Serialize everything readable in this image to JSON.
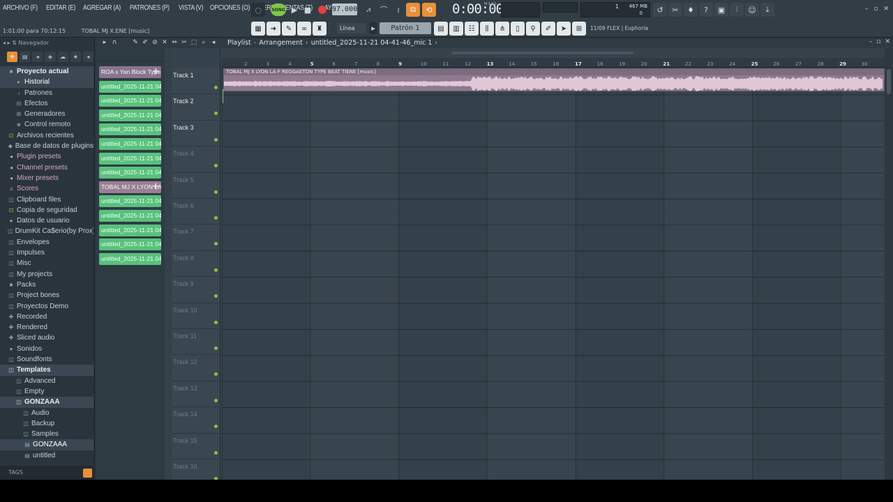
{
  "menu": [
    "ARCHIVO (F)",
    "EDITAR (E)",
    "AGREGAR (A)",
    "PATRONES (P)",
    "VISTA (V)",
    "OPCIONES (O)",
    "HERRAMIENTAS (T)",
    "AYUDA"
  ],
  "hint": {
    "position": "1:01:00 para 70:12:15",
    "song_name": "TOBAL MJ X.ENE [music]"
  },
  "transport": {
    "song_mode": "SONG",
    "tempo": "97.000",
    "time": "0:00:00",
    "time_unit_label": "M:S:CS"
  },
  "monitor": {
    "cpu_value": "1",
    "ram": "467 MB",
    "polyphony": "0"
  },
  "toolbar": {
    "snap": "Línea",
    "pattern": "Patrón 1",
    "plugin_note": "11/09  FLEX | Euphoria"
  },
  "browser": {
    "title": "Navegador",
    "items": [
      {
        "label": "Proyecto actual",
        "icon": "■",
        "level": 0,
        "kind": "hl"
      },
      {
        "label": "Historial",
        "icon": "▸",
        "level": 1,
        "kind": "sel"
      },
      {
        "label": "Patrones",
        "icon": "♪",
        "level": 1,
        "kind": ""
      },
      {
        "label": "Efectos",
        "icon": "⊟",
        "level": 1,
        "kind": ""
      },
      {
        "label": "Generadores",
        "icon": "⊞",
        "level": 1,
        "kind": ""
      },
      {
        "label": "Control remoto",
        "icon": "◈",
        "level": 1,
        "kind": ""
      },
      {
        "label": "Archivos recientes",
        "icon": "⊡",
        "level": 0,
        "kind": "green"
      },
      {
        "label": "Base de datos de plugins",
        "icon": "◆",
        "level": 0,
        "kind": ""
      },
      {
        "label": "Plugin presets",
        "icon": "◂",
        "level": 0,
        "kind": "pink"
      },
      {
        "label": "Channel presets",
        "icon": "◂",
        "level": 0,
        "kind": "pink"
      },
      {
        "label": "Mixer presets",
        "icon": "◂",
        "level": 0,
        "kind": "pink"
      },
      {
        "label": "Scores",
        "icon": "♫",
        "level": 0,
        "kind": "pink"
      },
      {
        "label": "Clipboard files",
        "icon": "◫",
        "level": 0,
        "kind": ""
      },
      {
        "label": "Copia de seguridad",
        "icon": "⊡",
        "level": 0,
        "kind": "green"
      },
      {
        "label": "Datos de usuario",
        "icon": "●",
        "level": 0,
        "kind": ""
      },
      {
        "label": "DrumKit Ca$erio(by Prox)",
        "icon": "◫",
        "level": 0,
        "kind": ""
      },
      {
        "label": "Envelopes",
        "icon": "◫",
        "level": 0,
        "kind": ""
      },
      {
        "label": "Impulses",
        "icon": "◫",
        "level": 0,
        "kind": ""
      },
      {
        "label": "Misc",
        "icon": "◫",
        "level": 0,
        "kind": ""
      },
      {
        "label": "My projects",
        "icon": "◫",
        "level": 0,
        "kind": ""
      },
      {
        "label": "Packs",
        "icon": "■",
        "level": 0,
        "kind": ""
      },
      {
        "label": "Project bones",
        "icon": "◫",
        "level": 0,
        "kind": ""
      },
      {
        "label": "Proyectos Demo",
        "icon": "◫",
        "level": 0,
        "kind": ""
      },
      {
        "label": "Recorded",
        "icon": "✚",
        "level": 0,
        "kind": ""
      },
      {
        "label": "Rendered",
        "icon": "✚",
        "level": 0,
        "kind": ""
      },
      {
        "label": "Sliced audio",
        "icon": "✚",
        "level": 0,
        "kind": ""
      },
      {
        "label": "Sonidos",
        "icon": "●",
        "level": 0,
        "kind": ""
      },
      {
        "label": "Soundfonts",
        "icon": "◫",
        "level": 0,
        "kind": ""
      },
      {
        "label": "Templates",
        "icon": "◫",
        "level": 0,
        "kind": "hl"
      },
      {
        "label": "Advanced",
        "icon": "◫",
        "level": 1,
        "kind": ""
      },
      {
        "label": "Empty",
        "icon": "◫",
        "level": 1,
        "kind": ""
      },
      {
        "label": "GONZAAA",
        "icon": "◫",
        "level": 1,
        "kind": "hl"
      },
      {
        "label": "Audio",
        "icon": "◫",
        "level": 2,
        "kind": ""
      },
      {
        "label": "Backup",
        "icon": "◫",
        "level": 2,
        "kind": ""
      },
      {
        "label": "Samples",
        "icon": "◫",
        "level": 2,
        "kind": ""
      },
      {
        "label": "GONZAAA",
        "icon": "▤",
        "level": 3,
        "kind": "sel"
      },
      {
        "label": "untitled",
        "icon": "▤",
        "level": 3,
        "kind": ""
      }
    ],
    "tags_label": "TAGS"
  },
  "playlist": {
    "title": "Playlist",
    "view": "Arrangement",
    "pattern_name": "untitled_2025-11-21 04-41-46_mic 1",
    "picker": [
      {
        "label": "ROA x Yan Block Type...",
        "type": "audio first"
      },
      {
        "label": "untitled_2025-11-21 04-...",
        "type": ""
      },
      {
        "label": "untitled_2025-11-21 04-...",
        "type": ""
      },
      {
        "label": "untitled_2025-11-21 04-...",
        "type": ""
      },
      {
        "label": "untitled_2025-11-21 04-...",
        "type": ""
      },
      {
        "label": "untitled_2025-11-21 04-...",
        "type": ""
      },
      {
        "label": "untitled_2025-11-21 04-...",
        "type": ""
      },
      {
        "label": "untitled_2025-11-21 04-...",
        "type": ""
      },
      {
        "label": "TOBAL MJ X LYON LA...",
        "type": "audio"
      },
      {
        "label": "untitled_2025-11-21 04-...",
        "type": ""
      },
      {
        "label": "untitled_2025-11-21 04-...",
        "type": ""
      },
      {
        "label": "untitled_2025-11-21 04-...",
        "type": ""
      },
      {
        "label": "untitled_2025-11-21 04-...",
        "type": ""
      },
      {
        "label": "untitled_2025-11-21 04-...",
        "type": ""
      }
    ],
    "tracks": [
      "Track 1",
      "Track 2",
      "Track 3",
      "Track 4",
      "Track 5",
      "Track 6",
      "Track 7",
      "Track 8",
      "Track 9",
      "Track 10",
      "Track 11",
      "Track 12",
      "Track 13",
      "Track 14",
      "Track 15",
      "Track 16"
    ],
    "bars": [
      "2",
      "3",
      "4",
      "5",
      "6",
      "7",
      "8",
      "9",
      "10",
      "11",
      "12",
      "13",
      "14",
      "15",
      "16",
      "17",
      "18",
      "19",
      "20",
      "21",
      "22",
      "23",
      "24",
      "25",
      "26",
      "27",
      "28",
      "29",
      "30"
    ],
    "audio_clip_label": "TOBAL MJ X LYON LA F REGGAETON TYPE BEAT TIENE [music]",
    "colors": {
      "pattern_clip": "#59c17d",
      "audio_clip": "#8d7a8f",
      "accent": "#e8903a"
    }
  }
}
